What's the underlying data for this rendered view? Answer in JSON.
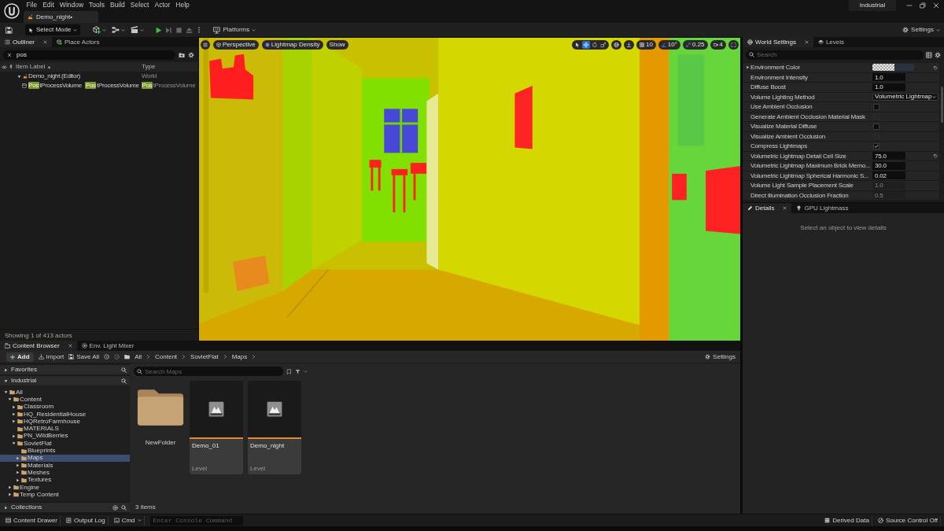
{
  "title_bar": {
    "menu": [
      "File",
      "Edit",
      "Window",
      "Tools",
      "Build",
      "Select",
      "Actor",
      "Help"
    ],
    "document_tab": {
      "label": "Demo_night•",
      "selected": true
    },
    "project": "Industrial"
  },
  "toolbar": {
    "mode_button": "Select Mode",
    "play_controls": [
      {
        "kind": "play",
        "disabled": false
      },
      {
        "kind": "advance",
        "disabled": true
      },
      {
        "kind": "stop",
        "disabled": true
      },
      {
        "kind": "eject",
        "disabled": true
      }
    ],
    "platforms_button": "Platforms",
    "settings_button": "Settings"
  },
  "outliner": {
    "tabs": [
      {
        "kind": "outliner",
        "label": "Outliner",
        "closable": true,
        "selected": true
      },
      {
        "kind": "place_actors",
        "label": "Place Actors",
        "closable": false,
        "selected": false
      }
    ],
    "search": {
      "value": "pos"
    },
    "columns": [
      {
        "label": "Item Label",
        "sort_ascending": true
      },
      {
        "label": "Type"
      }
    ],
    "rows": [
      {
        "kind": "level",
        "expanded": true,
        "label_parts": [
          {
            "text": "Demo_night (Editor)",
            "match": false
          }
        ],
        "type_parts": [
          {
            "text": "World",
            "match": false
          }
        ],
        "children": [
          {
            "kind": "actor",
            "label_parts": [
              {
                "text": "Pos",
                "match": true
              },
              {
                "text": "tProcessVolume",
                "match": false
              }
            ],
            "column_2_parts": [
              {
                "text": "Pos",
                "match": true
              },
              {
                "text": "tProcessVolume",
                "match": false
              }
            ],
            "type_parts": [
              {
                "text": "Pos",
                "match": true
              },
              {
                "text": "tProcessVolume",
                "match": false
              }
            ]
          }
        ]
      }
    ],
    "status": "Showing 1 of 413 actors"
  },
  "viewport": {
    "view_buttons": [
      {
        "kind": "view",
        "label": "Perspective"
      },
      {
        "kind": "view_mode",
        "label": "Lightmap Density"
      },
      {
        "kind": "show",
        "label": "Show"
      }
    ],
    "transform_tools": [
      {
        "kind": "select",
        "selected": false
      },
      {
        "kind": "translate",
        "selected": true
      },
      {
        "kind": "rotate",
        "selected": false
      },
      {
        "kind": "scale",
        "selected": false
      }
    ],
    "snaps": [
      {
        "kind": "grid",
        "value": "10",
        "on": false
      },
      {
        "kind": "rotation",
        "value": "10°",
        "on": true
      },
      {
        "kind": "scale",
        "value": "0.25",
        "on": true
      }
    ],
    "camera_speed": "4"
  },
  "world_settings": {
    "tabs": [
      {
        "kind": "world_settings",
        "label": "World Settings",
        "closable": true,
        "selected": true
      },
      {
        "kind": "levels",
        "label": "Levels",
        "closable": false,
        "selected": false
      }
    ],
    "search": {
      "placeholder": "Search"
    },
    "properties": [
      {
        "kind": "color",
        "label": "Environment Color",
        "expanded": false,
        "disabled": false,
        "modified": true
      },
      {
        "kind": "number",
        "label": "Environment Intensity",
        "value": "1.0",
        "disabled": false,
        "modified": false
      },
      {
        "kind": "number",
        "label": "Diffuse Boost",
        "value": "1.0",
        "disabled": false,
        "modified": false
      },
      {
        "kind": "dropdown",
        "label": "Volume Lighting Method",
        "value": "Volumetric Lightmap",
        "disabled": false,
        "modified": false
      },
      {
        "kind": "checkbox",
        "label": "Use Ambient Occlusion",
        "checked": false,
        "disabled": false,
        "modified": false
      },
      {
        "kind": "checkbox",
        "label": "Generate Ambient Occlusion Material Mask",
        "checked": false,
        "disabled": true,
        "modified": false
      },
      {
        "kind": "checkbox",
        "label": "Visualize Material Diffuse",
        "checked": false,
        "disabled": false,
        "modified": false
      },
      {
        "kind": "checkbox",
        "label": "Visualize Ambient Occlusion",
        "checked": false,
        "disabled": true,
        "modified": false
      },
      {
        "kind": "checkbox",
        "label": "Compress Lightmaps",
        "checked": true,
        "disabled": false,
        "modified": false
      },
      {
        "kind": "number",
        "label": "Volumetric Lightmap Detail Cell Size",
        "value": "75.0",
        "disabled": false,
        "modified": true
      },
      {
        "kind": "number",
        "label": "Volumetric Lightmap Maximum Brick Memo...",
        "value": "30.0",
        "disabled": false,
        "modified": false
      },
      {
        "kind": "number",
        "label": "Volumetric Lightmap Spherical Harmonic S...",
        "value": "0.02",
        "disabled": false,
        "modified": false
      },
      {
        "kind": "number",
        "label": "Volume Light Sample Placement Scale",
        "value": "1.0",
        "disabled": true,
        "modified": false
      },
      {
        "kind": "number",
        "label": "Direct Illumination Occlusion Fraction",
        "value": "0.5",
        "disabled": true,
        "modified": false
      }
    ]
  },
  "details": {
    "tabs": [
      {
        "kind": "details",
        "label": "Details",
        "closable": true,
        "selected": true
      },
      {
        "kind": "gpu_lightmass",
        "label": "GPU Lightmass",
        "closable": false,
        "selected": false
      }
    ],
    "empty_message": "Select an object to view details"
  },
  "content_browser": {
    "tabs": [
      {
        "kind": "content_browser",
        "label": "Content Browser",
        "closable": true,
        "selected": true
      },
      {
        "kind": "env_light_mixer",
        "label": "Env. Light Mixer",
        "closable": false,
        "selected": false
      }
    ],
    "add_button": "Add",
    "import_button": "Import",
    "save_all_button": "Save All",
    "breadcrumbs": [
      "All",
      "Content",
      "SovietFlat",
      "Maps"
    ],
    "settings_button": "Settings",
    "sources": {
      "sections": [
        {
          "label": "Favorites",
          "expanded": false
        },
        {
          "label": "Industrial",
          "expanded": true,
          "tree": [
            {
              "label": "All",
              "expandable": true,
              "expanded": true,
              "selected": false,
              "children": [
                {
                  "label": "Content",
                  "expandable": true,
                  "expanded": true,
                  "selected": false,
                  "children": [
                    {
                      "label": "Classroom",
                      "expandable": true,
                      "expanded": false,
                      "selected": false
                    },
                    {
                      "label": "HQ_ResidentialHouse",
                      "expandable": true,
                      "expanded": false,
                      "selected": false
                    },
                    {
                      "label": "HQRetroFarmhouse",
                      "expandable": true,
                      "expanded": false,
                      "selected": false
                    },
                    {
                      "label": "MATERIALS",
                      "expandable": false,
                      "selected": false
                    },
                    {
                      "label": "PN_WildBerries",
                      "expandable": true,
                      "expanded": false,
                      "selected": false
                    },
                    {
                      "label": "SovietFlat",
                      "expandable": true,
                      "expanded": true,
                      "selected": false,
                      "children": [
                        {
                          "label": "Blueprints",
                          "expandable": false,
                          "selected": false
                        },
                        {
                          "label": "Maps",
                          "expandable": true,
                          "expanded": false,
                          "selected": true
                        },
                        {
                          "label": "Materials",
                          "expandable": true,
                          "expanded": false,
                          "selected": false
                        },
                        {
                          "label": "Meshes",
                          "expandable": true,
                          "expanded": false,
                          "selected": false
                        },
                        {
                          "label": "Textures",
                          "expandable": true,
                          "expanded": false,
                          "selected": false
                        }
                      ]
                    }
                  ]
                },
                {
                  "label": "Engine",
                  "expandable": true,
                  "expanded": false,
                  "selected": false
                },
                {
                  "label": "Temp Content",
                  "expandable": true,
                  "expanded": false,
                  "selected": false
                }
              ]
            }
          ]
        }
      ],
      "collections": {
        "label": "Collections",
        "expanded": false
      }
    },
    "search": {
      "placeholder": "Search Maps"
    },
    "assets": [
      {
        "kind": "folder",
        "name": "NewFolder"
      },
      {
        "kind": "level",
        "name": "Demo_01",
        "type": "Level"
      },
      {
        "kind": "level",
        "name": "Demo_night",
        "type": "Level"
      }
    ],
    "item_count": "3 items"
  },
  "status_bar": {
    "content_drawer": "Content Drawer",
    "output_log": "Output Log",
    "cmd": "Cmd",
    "console": {
      "placeholder": "Enter Console Command"
    },
    "derived_data": "Derived Data",
    "source_control": "Source Control Off"
  }
}
